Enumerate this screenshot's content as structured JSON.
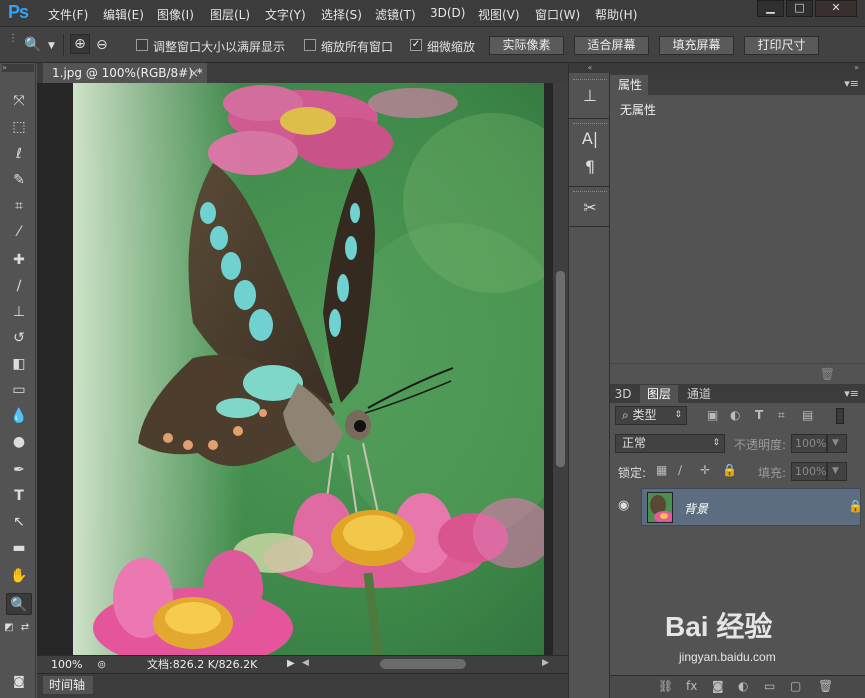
{
  "app": {
    "logo": "Ps",
    "menu": [
      "文件(F)",
      "编辑(E)",
      "图像(I)",
      "图层(L)",
      "文字(Y)",
      "选择(S)",
      "滤镜(T)",
      "3D(D)",
      "视图(V)",
      "窗口(W)",
      "帮助(H)"
    ]
  },
  "window_controls": {
    "minimize": "▁",
    "maximize": "□",
    "close": "✕"
  },
  "options_bar": {
    "tool_icon": "zoom-icon",
    "checkbox_resize": {
      "label": "调整窗口大小以满屏显示",
      "checked": false
    },
    "checkbox_zoom_all": {
      "label": "缩放所有窗口",
      "checked": false
    },
    "checkbox_scrubby": {
      "label": "细微缩放",
      "checked": true
    },
    "buttons": [
      "实际像素",
      "适合屏幕",
      "填充屏幕",
      "打印尺寸"
    ]
  },
  "document": {
    "tab_title": "1.jpg @ 100%(RGB/8#) *",
    "tab_close": "×",
    "zoom": "100%",
    "status": "文档:826.2 K/826.2K"
  },
  "timeline": {
    "tab_label": "时间轴"
  },
  "properties_panel": {
    "tab_label": "属性",
    "empty_text": "无属性"
  },
  "layers_panel": {
    "tabs": [
      "3D",
      "图层",
      "通道"
    ],
    "active_tab": "图层",
    "filter_label": "类型",
    "blend_mode": "正常",
    "opacity_label": "不透明度:",
    "opacity_value": "100%",
    "lock_label": "锁定:",
    "fill_label": "填充:",
    "fill_value": "100%",
    "layers": [
      {
        "name": "背景",
        "locked": true,
        "visible": true
      }
    ]
  },
  "watermark": {
    "logo": "Bai 经验",
    "url": "jingyan.baidu.com"
  },
  "colors": {
    "highlight_layer": "#5d6d81",
    "accent": "#2fa3f5",
    "foreground": "#000000",
    "background": "#ffffff"
  }
}
